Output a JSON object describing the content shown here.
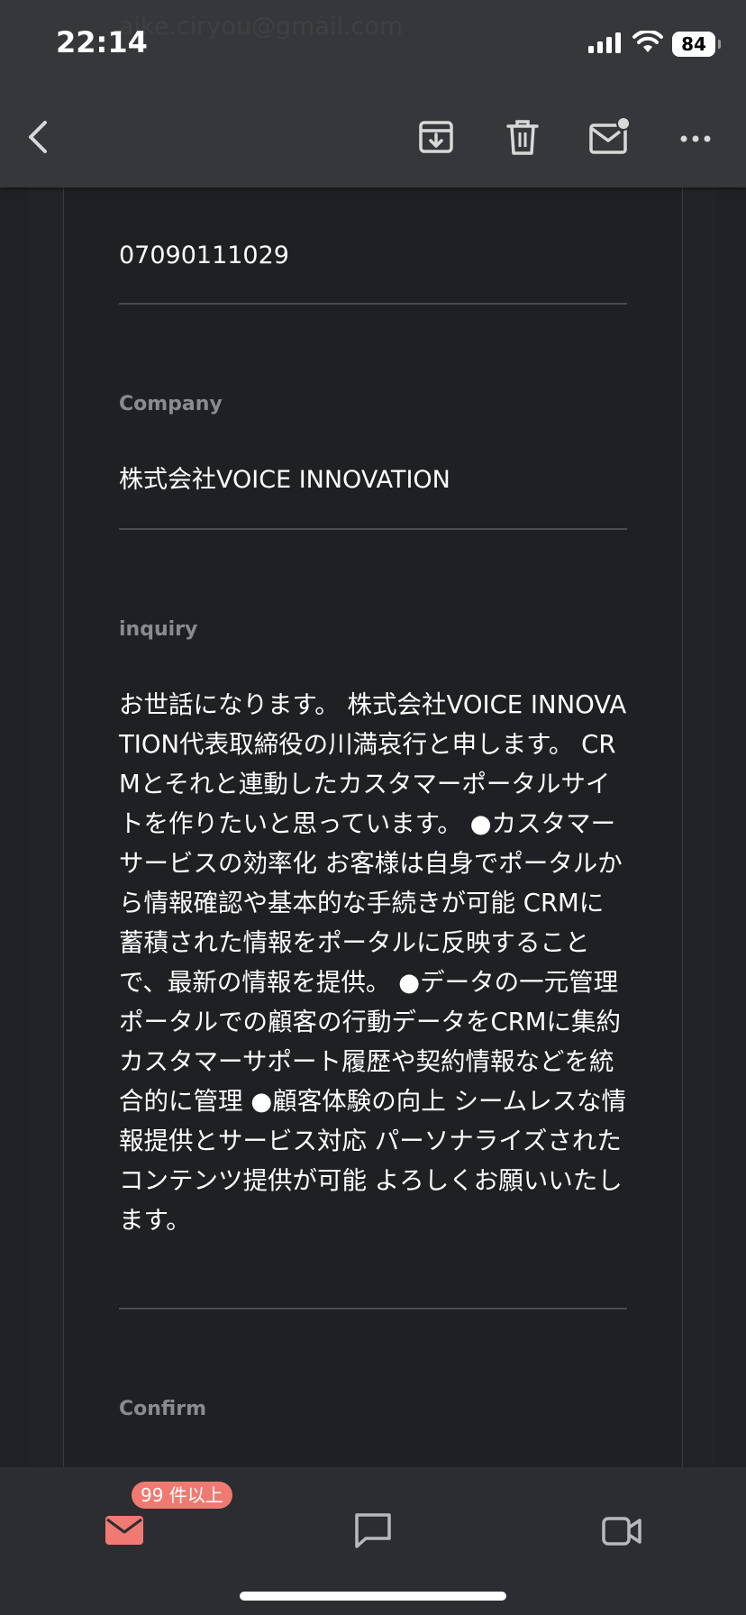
{
  "status_bar": {
    "time": "22:14",
    "battery": "84"
  },
  "email": {
    "faded_header": "aike.ciryou@gmail.com",
    "phone_value": "07090111029",
    "company_label": "Company",
    "company_value": "株式会社VOICE INNOVATION",
    "inquiry_label": "inquiry",
    "inquiry_text": "お世話になります。 株式会社VOICE INNOVATION代表取締役の川満哀行と申します。 CRMとそれと連動したカスタマーポータルサイトを作りたいと思っています。 ●カスタマーサービスの効率化 お客様は自身でポータルから情報確認や基本的な手続きが可能 CRMに蓄積された情報をポータルに反映することで、最新の情報を提供。 ●データの一元管理 ポータルでの顧客の行動データをCRMに集約 カスタマーサポート履歴や契約情報などを統合的に管理 ●顧客体験の向上 シームレスな情報提供とサービス対応 パーソナライズされたコンテンツ提供が可能 よろしくお願いいたします。",
    "confirm_label": "Confirm"
  },
  "bottom_bar": {
    "mail_badge": "99 件以上"
  },
  "colors": {
    "accent": "#f07a72",
    "background": "#202124",
    "topbar": "#36373a"
  }
}
